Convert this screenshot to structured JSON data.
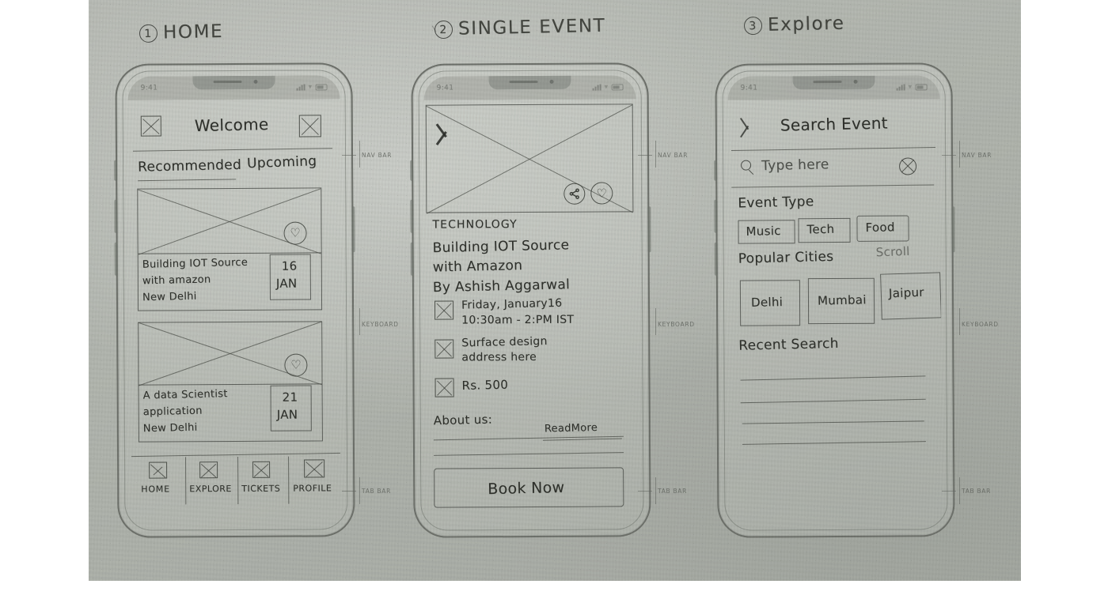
{
  "document": {
    "type": "hand-drawn mobile app wireframe sketch",
    "screens_count": 3
  },
  "status_bar": {
    "time": "9:41"
  },
  "annotations": {
    "nav_bar": "NAV BAR",
    "keyboard": "KEYBOARD",
    "tab_bar": "TAB BAR"
  },
  "screen1": {
    "number": "1",
    "title": "HOME",
    "nav": {
      "left_icon": "menu-placeholder-icon",
      "title": "Welcome",
      "right_icon": "avatar-placeholder-icon"
    },
    "tabs": [
      {
        "label": "Recommended",
        "active": true
      },
      {
        "label": "Upcoming",
        "active": false
      }
    ],
    "cards": [
      {
        "image": "image-placeholder",
        "favorite_icon": "heart-icon",
        "title_line1": "Building IOT Source",
        "title_line2": "with amazon",
        "location": "New Delhi",
        "date_day": "16",
        "date_month": "JAN"
      },
      {
        "image": "image-placeholder",
        "favorite_icon": "heart-icon",
        "title_line1": "A data Scientist",
        "title_line2": "application",
        "location": "New Delhi",
        "date_day": "21",
        "date_month": "JAN"
      }
    ],
    "tab_bar_items": [
      {
        "label": "HOME",
        "icon": "home-icon"
      },
      {
        "label": "EXPLORE",
        "icon": "explore-icon"
      },
      {
        "label": "TICKETS",
        "icon": "tickets-icon"
      },
      {
        "label": "PROFILE",
        "icon": "profile-icon"
      }
    ]
  },
  "screen2": {
    "number": "2",
    "title": "SINGLE EVENT",
    "hero": {
      "image": "image-placeholder",
      "back_icon": "back-chevron-icon",
      "share_icon": "share-icon",
      "favorite_icon": "heart-icon"
    },
    "category": "TECHNOLOGY",
    "event_title_line1": "Building IOT Source",
    "event_title_line2": "with Amazon",
    "speaker": "By Ashish Aggarwal",
    "details": [
      {
        "icon": "calendar-placeholder-icon",
        "line1": "Friday, January16",
        "line2": "10:30am - 2:PM IST"
      },
      {
        "icon": "location-placeholder-icon",
        "line1": "Surface design",
        "line2": "address here"
      },
      {
        "icon": "price-placeholder-icon",
        "line1": "Rs. 500",
        "line2": ""
      }
    ],
    "about_label": "About us:",
    "read_more": "ReadMore",
    "cta": "Book Now"
  },
  "screen3": {
    "number": "3",
    "title": "Explore",
    "nav": {
      "back_icon": "back-chevron-icon",
      "title": "Search Event"
    },
    "search": {
      "icon": "search-icon",
      "placeholder": "Type here",
      "clear_icon": "clear-circle-icon"
    },
    "event_type_label": "Event Type",
    "event_types": [
      "Music",
      "Tech",
      "Food"
    ],
    "popular_cities_label": "Popular Cities",
    "scroll_hint": "Scroll",
    "cities": [
      "Delhi",
      "Mumbai",
      "Jaipur"
    ],
    "recent_search_label": "Recent Search",
    "recent_search_lines": 4
  }
}
